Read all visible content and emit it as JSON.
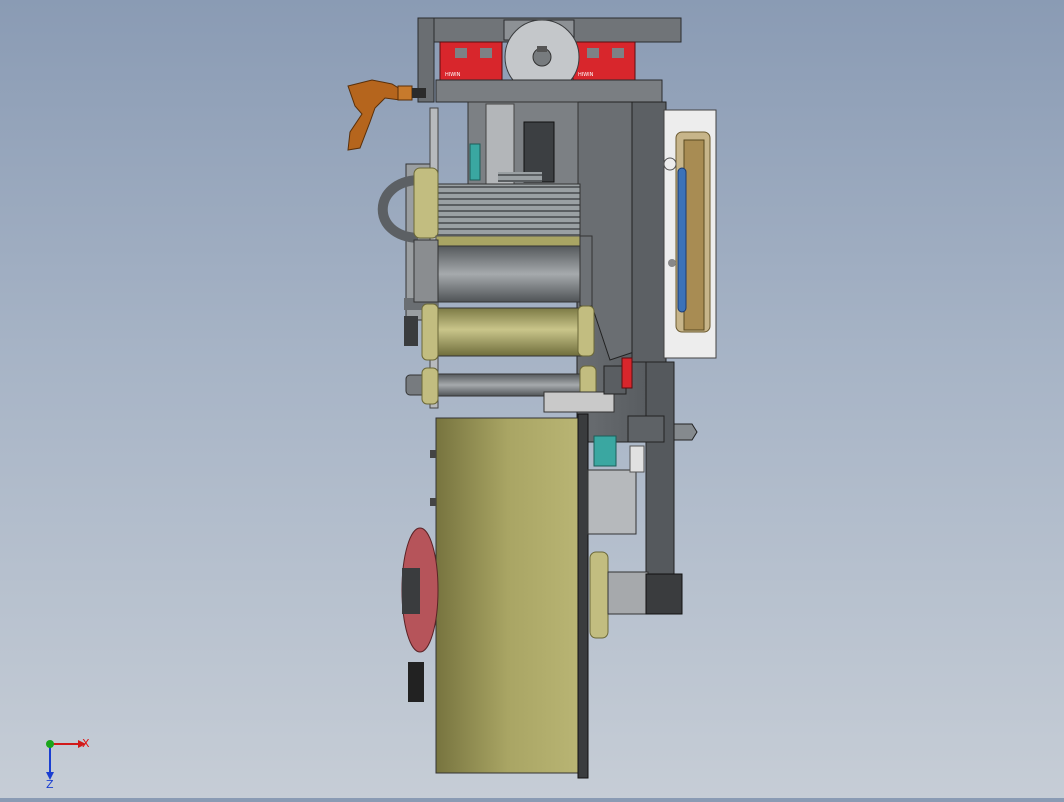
{
  "viewport": {
    "background_top": "#8a9bb4",
    "background_bottom": "#c6cdd6"
  },
  "model": {
    "colors": {
      "frame_dark": "#5e6266",
      "frame_mid": "#7d8185",
      "rail_red": "#d8262c",
      "handle_orange": "#b5651d",
      "roller_olive": "#a9a564",
      "roller_olive_dark": "#7c7a45",
      "roller_grey": "#8c8f91",
      "wheel_red": "#b6545a",
      "teal": "#3aa7a1",
      "blue_belt": "#3b72b8",
      "white_panel": "#f2f2f2"
    },
    "rail_markings": [
      "HIWIN",
      "HIWIN"
    ]
  },
  "triad": {
    "x_label": "X",
    "z_label": "Z",
    "x_color": "#d11a1a",
    "z_color": "#1a3ed1",
    "origin_color": "#1aa51a"
  }
}
